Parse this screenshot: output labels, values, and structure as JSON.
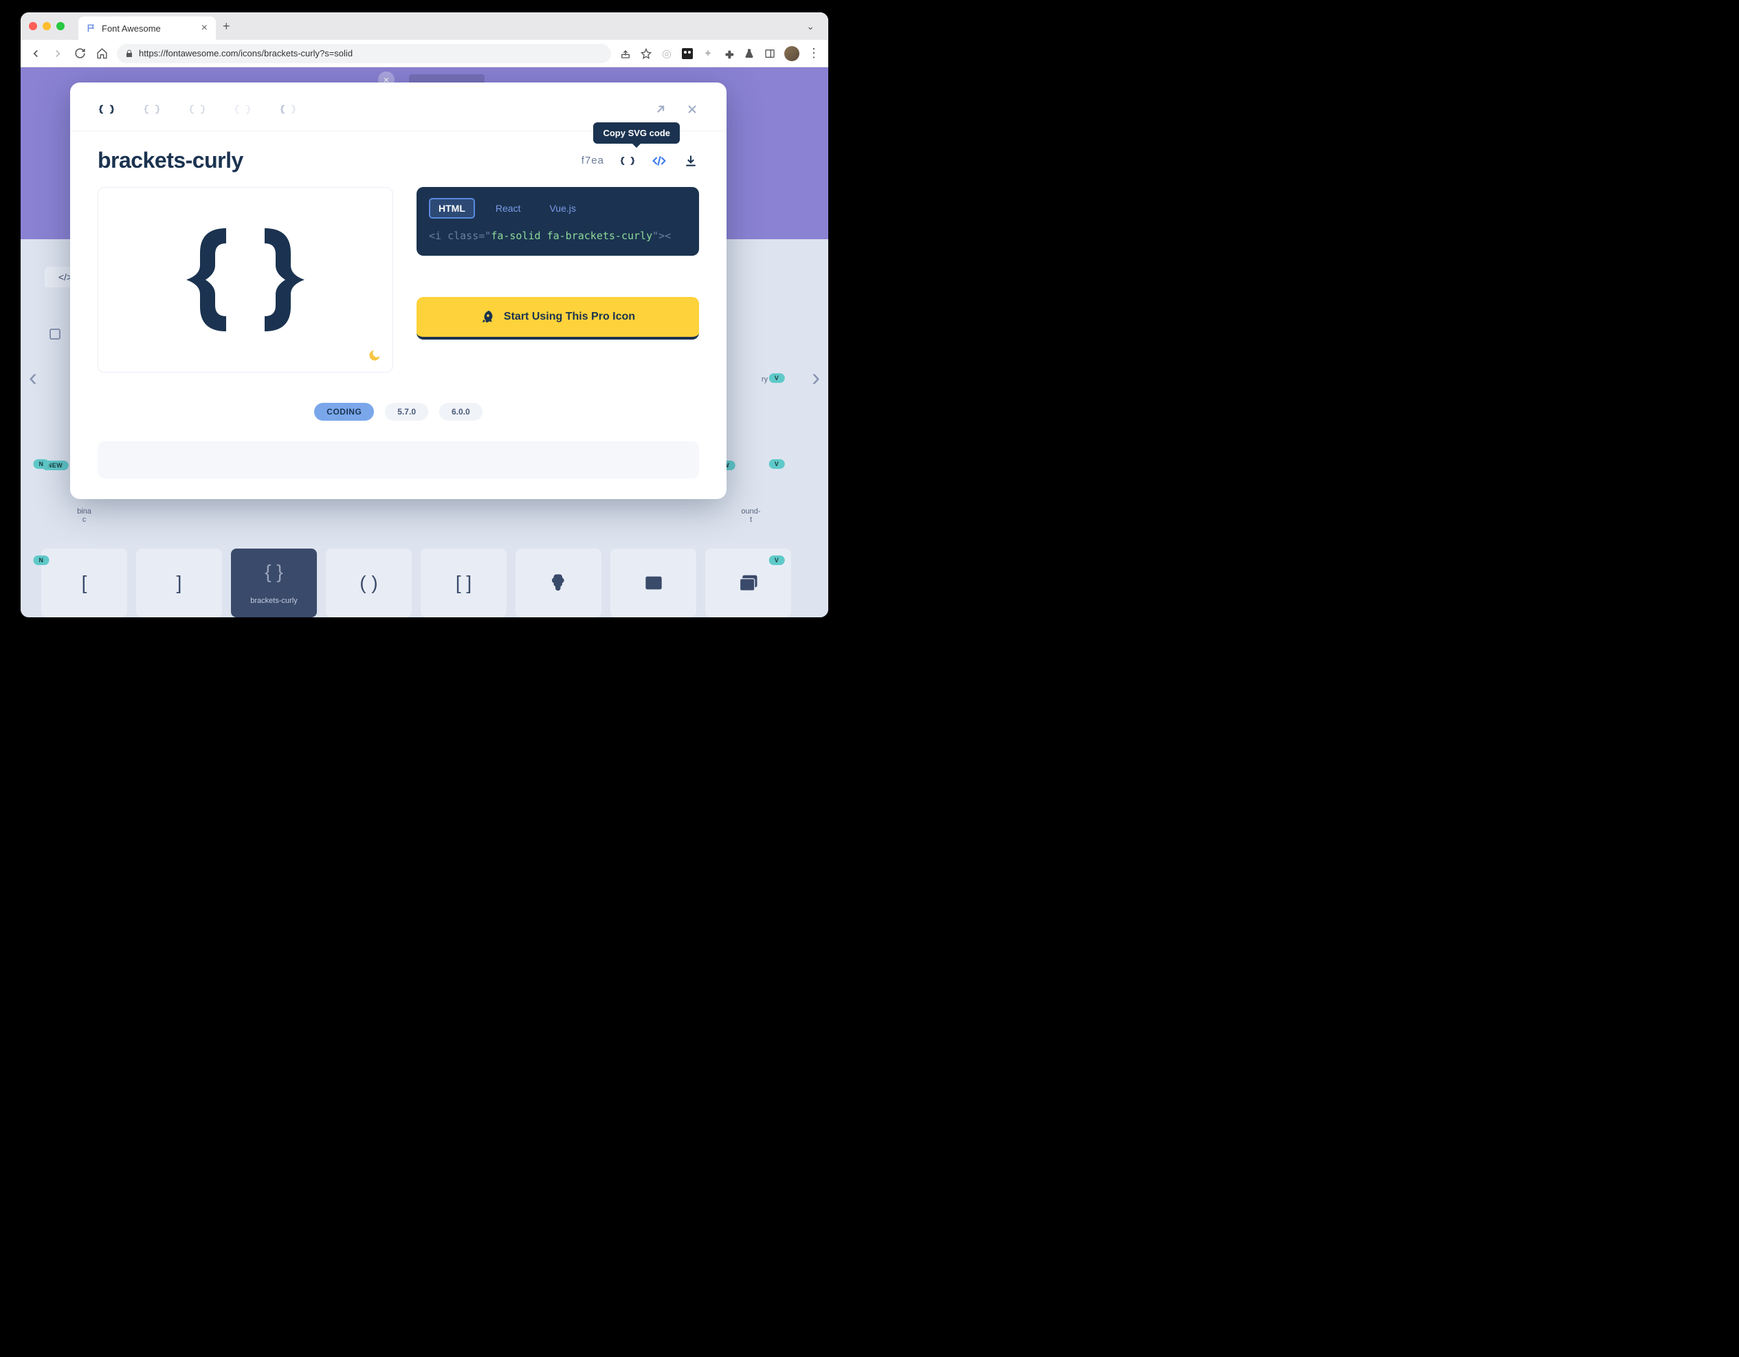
{
  "browser": {
    "tab_title": "Font Awesome",
    "url": "https://fontawesome.com/icons/brackets-curly?s=solid"
  },
  "modal": {
    "icon_name": "brackets-curly",
    "unicode": "f7ea",
    "tooltip_copy_svg": "Copy SVG code",
    "code_tabs": {
      "html": "HTML",
      "react": "React",
      "vue": "Vue.js"
    },
    "code_snippet_prefix": "<i class=\"",
    "code_snippet_class": "fa-solid fa-brackets-curly",
    "code_snippet_suffix": "\"><",
    "cta_label": "Start Using This Pro Icon",
    "tags": {
      "category": "CODING",
      "v1": "5.7.0",
      "v2": "6.0.0"
    }
  },
  "grid": {
    "items": [
      {
        "label": "bracket-square"
      },
      {
        "label": "bracket-square-right"
      },
      {
        "label": "brackets-curly"
      },
      {
        "label": "brackets-round"
      },
      {
        "label": "brackets-square"
      },
      {
        "label": "brain-circuit"
      },
      {
        "label": "browser"
      },
      {
        "label": "browsers"
      }
    ],
    "new_badge": "NEW"
  }
}
